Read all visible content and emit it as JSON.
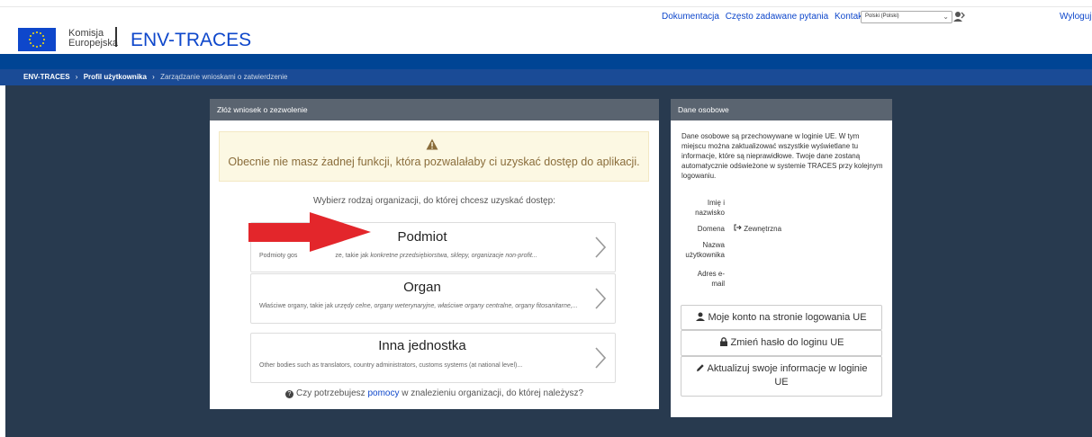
{
  "header": {
    "logo_line1": "Komisja",
    "logo_line2": "Europejska",
    "app_title": "ENV-TRACES",
    "links": [
      "Dokumentacja",
      "Często zadawane pytania",
      "Kontakt"
    ],
    "language": "Polski (Polski)",
    "logout": "Wyloguj"
  },
  "breadcrumb": {
    "items": [
      "ENV-TRACES",
      "Profil użytkownika",
      "Zarządzanie wnioskami o zatwierdzenie"
    ]
  },
  "left_panel": {
    "title": "Złóż wniosek o zezwolenie",
    "alert": "Obecnie nie masz żadnej funkcji, która pozwalałaby ci uzyskać dostęp do aplikacji.",
    "choose": "Wybierz rodzaj organizacji, do której chcesz uzyskać dostęp:",
    "cards": [
      {
        "title": "Podmiot",
        "desc_plain": "Podmioty gos",
        "desc_plain2": "ze, takie jak ",
        "desc_italic": "konkretne przedsiębiorstwa, sklepy, organizacje non-profit..."
      },
      {
        "title": "Organ",
        "desc_plain": "Właściwe organy, takie jak ",
        "desc_italic": "urzędy celne, organy weterynaryjne, właściwe organy centralne, organy fitosanitarne,",
        "desc_tail": "..."
      },
      {
        "title": "Inna jednostka",
        "desc_plain": "Other bodies such as translators, country administrators, customs systems (at national level)..."
      }
    ],
    "help_before": "Czy potrzebujesz ",
    "help_link": "pomocy",
    "help_after": " w znalezieniu organizacji, do której należysz?"
  },
  "right_panel": {
    "title": "Dane osobowe",
    "info": "Dane osobowe są przechowywane w loginie UE. W tym miejscu można zaktualizować wszystkie wyświetlane tu informacje, które są nieprawidłowe. Twoje dane zostaną automatycznie odświeżone w systemie TRACES przy kolejnym logowaniu.",
    "fields": {
      "name_l1": "Imię i",
      "name_l2": "nazwisko",
      "domain": "Domena",
      "domain_value": "Zewnętrzna",
      "user_l1": "Nazwa",
      "user_l2": "użytkownika",
      "email_l1": "Adres e-",
      "email_l2": "mail"
    },
    "buttons": {
      "account": "Moje konto na stronie logowania UE",
      "password": "Zmień hasło do loginu UE",
      "update_l1": "Aktualizuj swoje informacje w loginie",
      "update_l2": "UE"
    }
  },
  "colors": {
    "brand_blue": "#0e47cb",
    "dark_navy": "#004494",
    "bg_dark": "#283a4f",
    "panel_header": "#5a6470",
    "alert_bg": "#fcf8e3",
    "arrow_red": "#e3262b"
  }
}
